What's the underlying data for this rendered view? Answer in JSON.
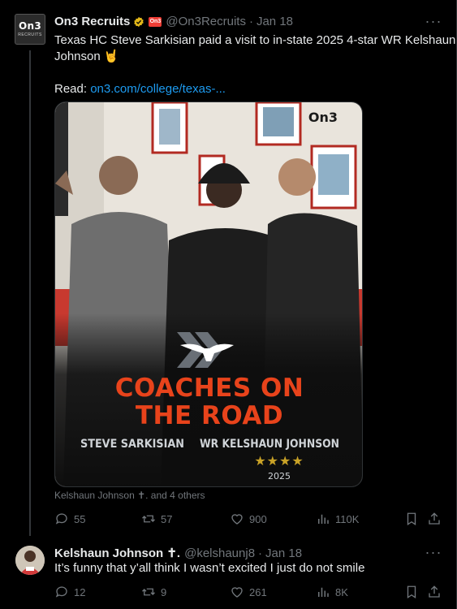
{
  "tweet1": {
    "author_name": "On3 Recruits",
    "avatar_text": "On3",
    "avatar_sub": "RECRUITS",
    "affiliate_badge": "On3",
    "handle": "@On3Recruits",
    "date": "Jan 18",
    "text_line1": "Texas HC Steve Sarkisian paid a visit to in-state 2025 4-star WR Kelshaun",
    "text_line2": "Johnson 🤘",
    "read_label": "Read:",
    "read_link": "on3.com/college/texas-...",
    "media": {
      "watermark": "On3",
      "headline_line1": "COACHES ON",
      "headline_line2": "THE ROAD",
      "left_name": "STEVE SARKISIAN",
      "right_name": "WR KELSHAUN JOHNSON",
      "stars": "★★★★",
      "year": "2025"
    },
    "tagged": "Kelshaun Johnson ✝. and 4 others",
    "stats": {
      "replies": "55",
      "reposts": "57",
      "likes": "900",
      "views": "110K"
    }
  },
  "tweet2": {
    "author_name": "Kelshaun Johnson ✝.",
    "handle": "@kelshaunj8",
    "date": "Jan 18",
    "text": "It’s funny that y’all think I wasn’t excited I just do not smile",
    "stats": {
      "replies": "12",
      "reposts": "9",
      "likes": "261",
      "views": "8K"
    }
  },
  "colors": {
    "background": "#000000",
    "text": "#e7e9ea",
    "muted": "#71767b",
    "link": "#1d9bf0",
    "accent_orange": "#e8431b"
  }
}
